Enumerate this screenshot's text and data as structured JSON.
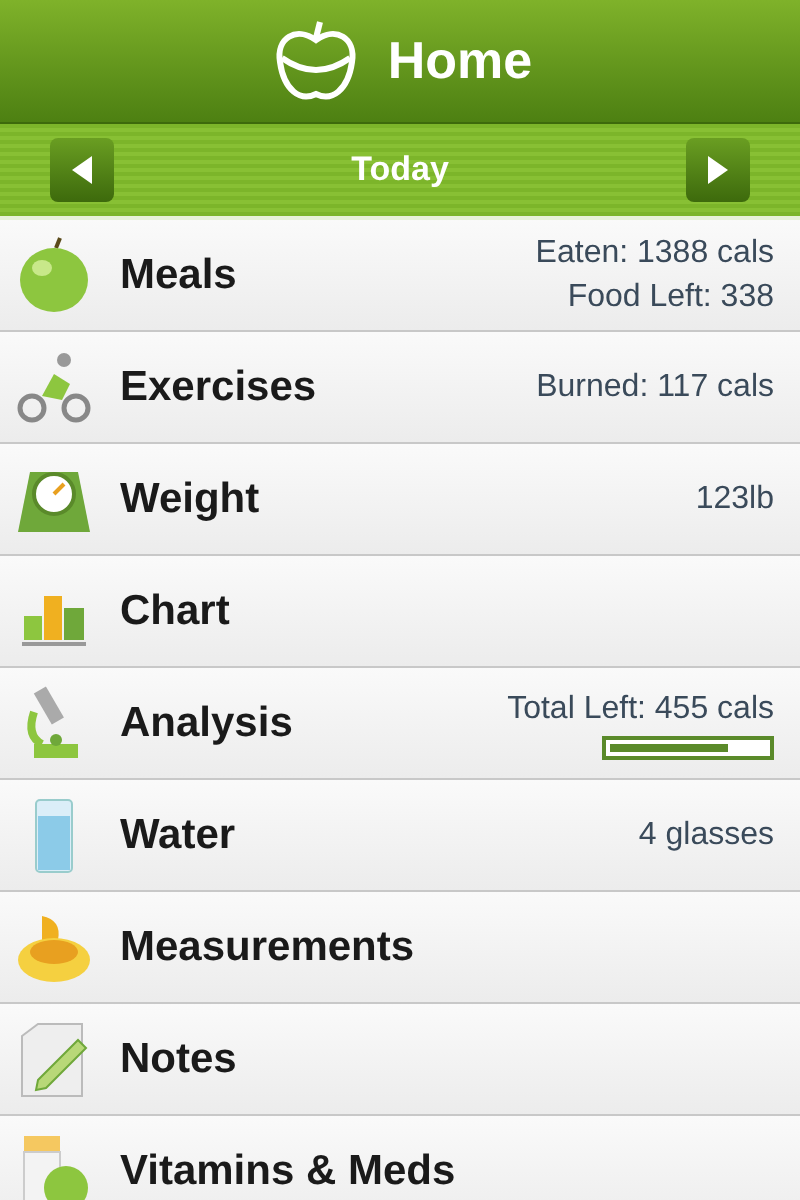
{
  "header": {
    "title": "Home"
  },
  "date_bar": {
    "label": "Today"
  },
  "items": [
    {
      "kind": "apple",
      "label": "Meals",
      "details": [
        "Eaten: 1388 cals",
        "Food Left: 338"
      ]
    },
    {
      "kind": "cyclist",
      "label": "Exercises",
      "details": [
        "Burned: 117 cals"
      ]
    },
    {
      "kind": "scale",
      "label": "Weight",
      "details": [
        "123lb"
      ]
    },
    {
      "kind": "chart",
      "label": "Chart"
    },
    {
      "kind": "microscope",
      "label": "Analysis",
      "details": [
        "Total Left: 455 cals"
      ],
      "level": 0.75
    },
    {
      "kind": "glass",
      "label": "Water",
      "details": [
        "4 glasses"
      ]
    },
    {
      "kind": "tape",
      "label": "Measurements"
    },
    {
      "kind": "note",
      "label": "Notes"
    },
    {
      "kind": "pills",
      "label": "Vitamins & Meds"
    }
  ]
}
